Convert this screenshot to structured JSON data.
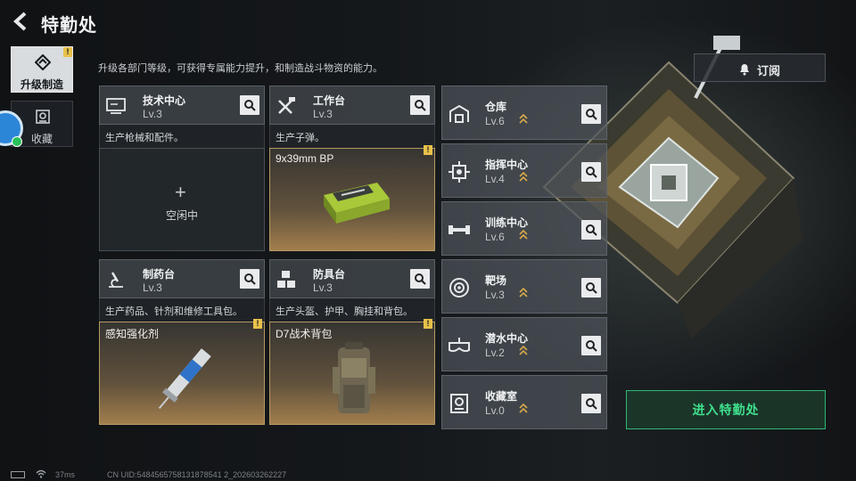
{
  "header": {
    "title": "特勤处",
    "subtitle": "升级各部门等级，可获得专属能力提升，和制造战斗物资的能力。"
  },
  "sidebar": {
    "tabs": [
      {
        "label": "升级制造",
        "active": true,
        "badge": "!"
      },
      {
        "label": "收藏",
        "active": false
      }
    ]
  },
  "facilities": [
    {
      "name": "技术中心",
      "level": "Lv.3",
      "icon": "monitor-icon",
      "desc": "生产枪械和配件。",
      "slot": {
        "state": "idle",
        "label": "空闲中",
        "plus": "+"
      }
    },
    {
      "name": "工作台",
      "level": "Lv.3",
      "icon": "tools-icon",
      "desc": "生产子弹。",
      "slot": {
        "state": "product",
        "label": "9x39mm BP",
        "badge": "!"
      }
    },
    {
      "name": "制药台",
      "level": "Lv.3",
      "icon": "microscope-icon",
      "desc": "生产药品、针剂和维修工具包。",
      "slot": {
        "state": "product",
        "label": "感知强化剂",
        "badge": "!"
      }
    },
    {
      "name": "防具台",
      "level": "Lv.3",
      "icon": "cubes-icon",
      "desc": "生产头盔、护甲、胸挂和背包。",
      "slot": {
        "state": "product",
        "label": "D7战术背包",
        "badge": "!"
      }
    }
  ],
  "departments": [
    {
      "name": "仓库",
      "level": "Lv.6",
      "icon": "warehouse-icon"
    },
    {
      "name": "指挥中心",
      "level": "Lv.4",
      "icon": "command-chip-icon"
    },
    {
      "name": "训练中心",
      "level": "Lv.6",
      "icon": "dumbbell-icon"
    },
    {
      "name": "靶场",
      "level": "Lv.3",
      "icon": "target-icon"
    },
    {
      "name": "潜水中心",
      "level": "Lv.2",
      "icon": "diving-mask-icon"
    },
    {
      "name": "收藏室",
      "level": "Lv.0",
      "icon": "collection-icon"
    }
  ],
  "subscribe": {
    "label": "订阅"
  },
  "enter": {
    "label": "进入特勤处"
  },
  "footer": {
    "ping": "37ms",
    "uid": "CN UID:5484565758131878541 2_202603262227"
  },
  "colors": {
    "accent_green": "#3fe08d",
    "badge_yellow": "#e8c14a",
    "upgrade_arrow": "#d9a94a"
  }
}
